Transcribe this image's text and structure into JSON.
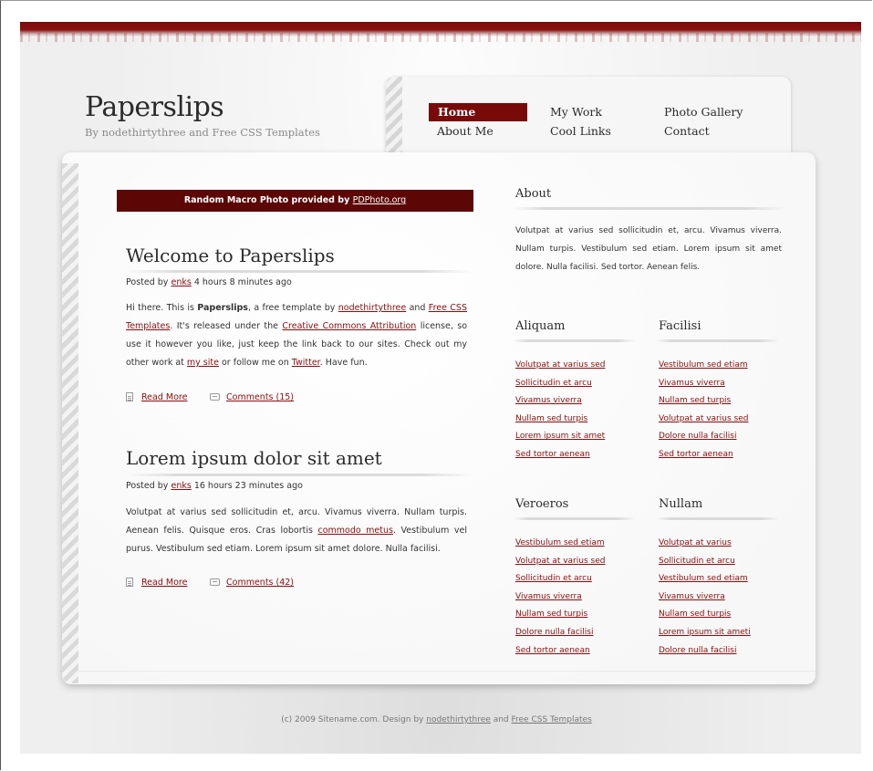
{
  "site": {
    "title": "Paperslips",
    "subtitle": "By nodethirtythree and Free CSS Templates"
  },
  "nav": {
    "items": [
      {
        "label": "Home",
        "active": true
      },
      {
        "label": "My Work",
        "active": false
      },
      {
        "label": "Photo Gallery",
        "active": false
      },
      {
        "label": "About Me",
        "active": false
      },
      {
        "label": "Cool Links",
        "active": false
      },
      {
        "label": "Contact",
        "active": false
      }
    ]
  },
  "banner": {
    "text": "Random Macro Photo provided by",
    "link": "PDPhoto.org"
  },
  "posts": [
    {
      "title": "Welcome to Paperslips",
      "meta_prefix": "Posted by",
      "author": "enks",
      "meta_suffix": "4 hours 8 minutes ago",
      "body": {
        "t1": "Hi there. This is ",
        "b1": "Paperslips",
        "t2": ", a free template by ",
        "l1": "nodethirtythree",
        "t3": " and ",
        "l2": "Free CSS Templates",
        "t4": ". It's released under the ",
        "l3": "Creative Commons Attribution",
        "t5": " license, so use it however you like, just keep the link back to our sites. Check out my other work at ",
        "l4": "my site",
        "t6": " or follow me on ",
        "l5": "Twitter",
        "t7": ". Have fun."
      },
      "read_more": "Read More",
      "comments": "Comments (15)"
    },
    {
      "title": "Lorem ipsum dolor sit amet",
      "meta_prefix": "Posted by",
      "author": "enks",
      "meta_suffix": "16 hours 23 minutes ago",
      "body": {
        "t1": "Volutpat at varius sed sollicitudin et, arcu. Vivamus viverra. Nullam turpis. Aenean felis. Quisque eros. Cras lobortis ",
        "l1": "commodo metus",
        "t2": ". Vestibulum vel purus. Vestibulum sed etiam. Lorem ipsum sit amet dolore. Nulla facilisi."
      },
      "read_more": "Read More",
      "comments": "Comments (42)"
    }
  ],
  "sidebar": {
    "about": {
      "heading": "About",
      "text": "Volutpat at varius sed sollicitudin et, arcu. Vivamus viverra. Nullam turpis. Vestibulum sed etiam. Lorem ipsum sit amet dolore. Nulla facilisi. Sed tortor. Aenean felis."
    },
    "lists": [
      {
        "heading": "Aliquam",
        "links": [
          "Volutpat at varius sed",
          "Sollicitudin et arcu",
          "Vivamus viverra",
          "Nullam sed turpis",
          "Lorem ipsum sit amet",
          "Sed tortor aenean"
        ]
      },
      {
        "heading": "Facilisi",
        "links": [
          "Vestibulum sed etiam",
          "Vivamus viverra",
          "Nullam sed turpis",
          "Volutpat at varius sed",
          "Dolore nulla facilisi",
          "Sed tortor aenean"
        ]
      },
      {
        "heading": "Veroeros",
        "links": [
          "Vestibulum sed etiam",
          "Volutpat at varius sed",
          "Sollicitudin et arcu",
          "Vivamus viverra",
          "Nullam sed turpis",
          "Dolore nulla facilisi",
          "Sed tortor aenean"
        ]
      },
      {
        "heading": "Nullam",
        "links": [
          "Volutpat at varius",
          "Sollicitudin et arcu",
          "Vestibulum sed etiam",
          "Vivamus viverra",
          "Nullam sed turpis",
          "Lorem ipsum sit ameti",
          "Dolore nulla facilisi"
        ]
      }
    ]
  },
  "footer": {
    "text": "(c) 2009 Sitename.com. Design by",
    "link1": "nodethirtythree",
    "and": "and",
    "link2": "Free CSS Templates"
  },
  "colors": {
    "accent": "#780a0a",
    "link": "#8b0d0d",
    "background": "#efefef"
  },
  "icons": {
    "read_more": "document-icon",
    "comments": "comment-bubble-icon"
  }
}
